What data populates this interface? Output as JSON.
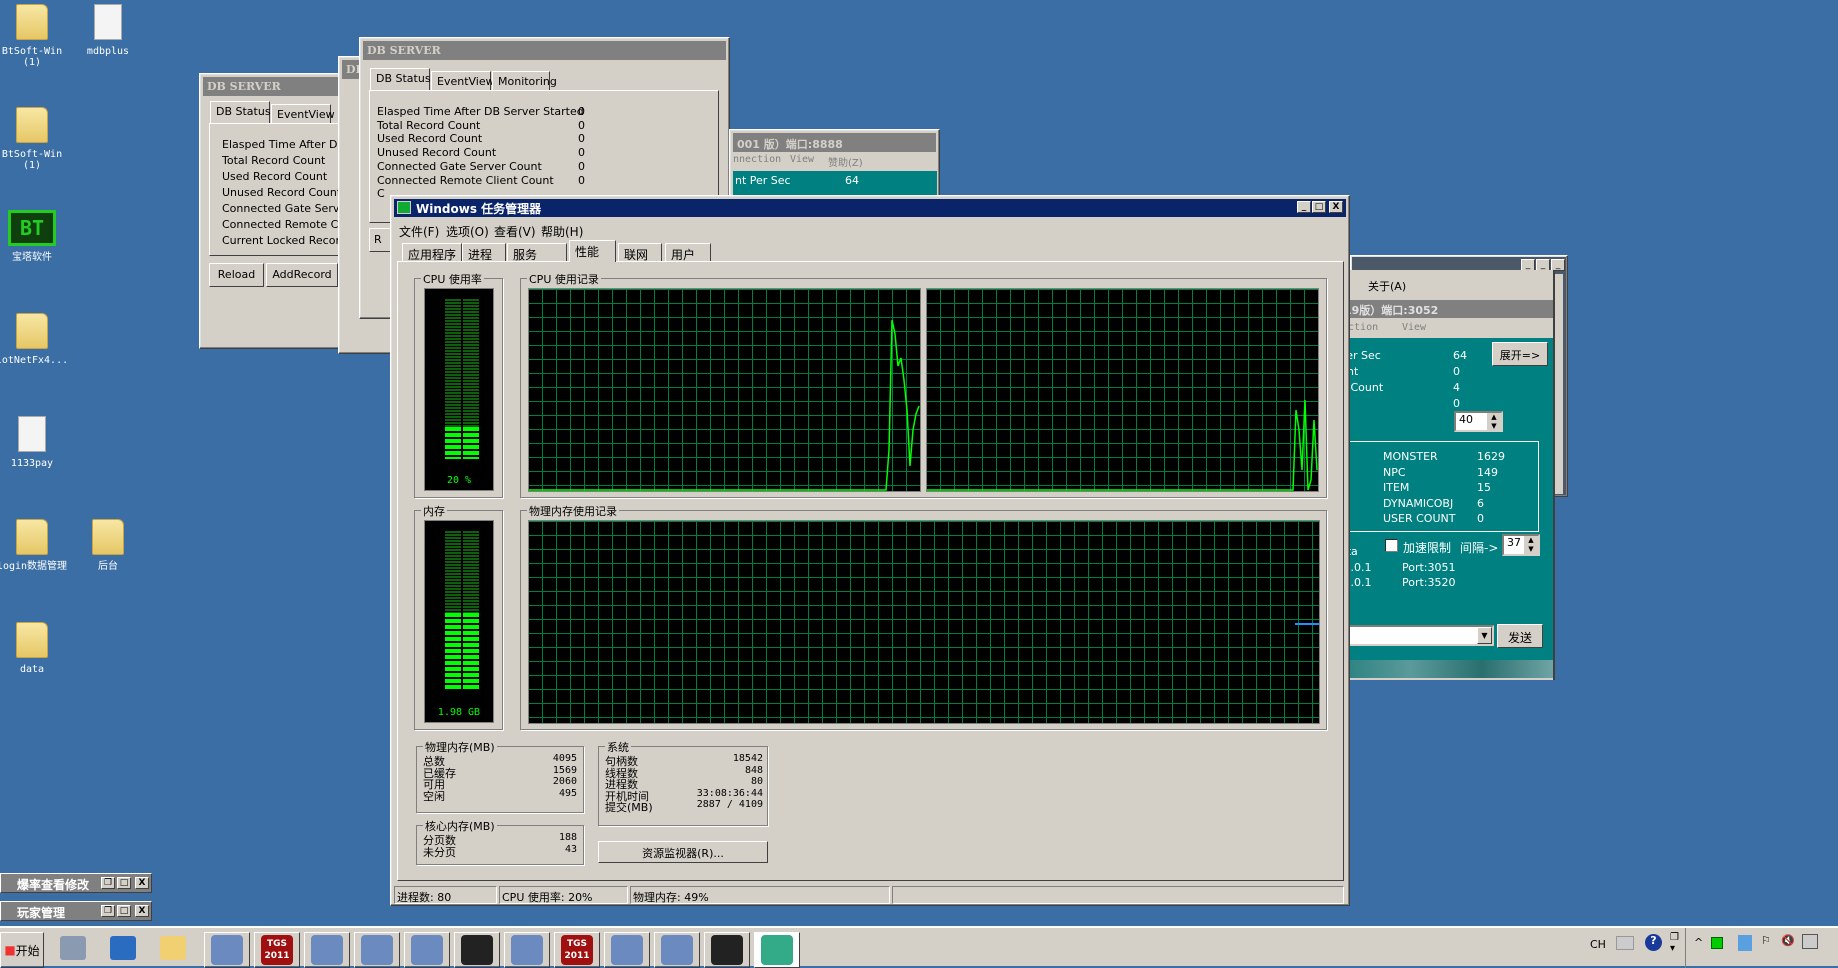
{
  "desktop": {
    "icons": [
      {
        "label": "BtSoft-Win\n(1)",
        "icon": "zip-folder-icon"
      },
      {
        "label": "mdbplus",
        "icon": "config-file-icon"
      },
      {
        "label": "BtSoft-Win\n(1)",
        "icon": "folder-icon"
      },
      {
        "label": "宝塔软件",
        "icon": "bt-panel-shortcut-icon"
      },
      {
        "label": "lotNetFx4...",
        "icon": "zip-folder-icon"
      },
      {
        "label": "1133pay",
        "icon": "notepad-file-icon"
      },
      {
        "label": "login数据管理",
        "icon": "folder-icon"
      },
      {
        "label": "后台",
        "icon": "folder-icon"
      },
      {
        "label": "data",
        "icon": "folder-icon"
      }
    ]
  },
  "db_server_back": {
    "title": "DB SERVER",
    "tabs": [
      "DB Status",
      "EventView"
    ],
    "rows": [
      "Elasped Time After DB S",
      "Total Record Count",
      "Used Record Count",
      "Unused Record Count",
      "Connected Gate Server C",
      "Connected Remote Clien",
      "Current Locked Record C"
    ],
    "buttons": [
      "Reload",
      "AddRecord"
    ]
  },
  "db_server_mid": {
    "title": "DB"
  },
  "db_server_front": {
    "title": "DB SERVER",
    "tabs": [
      "DB Status",
      "EventView",
      "Monitoring"
    ],
    "rows": [
      {
        "label": "Elasped Time After DB Server Started",
        "value": "0"
      },
      {
        "label": "Total Record Count",
        "value": "0"
      },
      {
        "label": "Used Record Count",
        "value": "0"
      },
      {
        "label": "Unused Record Count",
        "value": "0"
      },
      {
        "label": "Connected Gate Server Count",
        "value": "0"
      },
      {
        "label": "Connected Remote Client Count",
        "value": "0"
      },
      {
        "label": "C",
        "value": ""
      }
    ],
    "button_partial": "R"
  },
  "gate_window": {
    "title": "001 版）端口:8888",
    "menu": [
      "nnection",
      "View",
      "赞助(Z)"
    ],
    "row_label": "nt Per Sec",
    "row_value": "64"
  },
  "server_window": {
    "menu": "关于(A)",
    "title": "19版）端口:3052",
    "submenu": [
      "ection",
      "View"
    ],
    "rows": [
      {
        "label": "Per Sec",
        "value": "64"
      },
      {
        "label": "unt",
        "value": "0"
      },
      {
        "label": "n Count",
        "value": "4"
      },
      {
        "label": "",
        "value": "0"
      }
    ],
    "expand_button": "展开=>",
    "spin_value": "40",
    "group_label": "n",
    "stats": [
      {
        "label": "MONSTER",
        "value": "1629"
      },
      {
        "label": "NPC",
        "value": "149"
      },
      {
        "label": "ITEM",
        "value": "15"
      },
      {
        "label": "DYNAMICOBJ",
        "value": "6"
      },
      {
        "label": "USER COUNT",
        "value": "0"
      }
    ],
    "data_label": "ata",
    "speed_limit_label": "加速限制",
    "speed_limit_checked": false,
    "interval_label": "间隔->",
    "interval_value": "37",
    "addresses": [
      {
        "ip": ".0.0.1",
        "port": "Port:3051"
      },
      {
        "ip": ".0.0.1",
        "port": "Port:3520"
      }
    ],
    "command_value": "",
    "send_button": "发送"
  },
  "task_manager": {
    "title": "Windows 任务管理器",
    "menu": [
      "文件(F)",
      "选项(O)",
      "查看(V)",
      "帮助(H)"
    ],
    "tabs": [
      "应用程序",
      "进程",
      "服务",
      "性能",
      "联网",
      "用户"
    ],
    "active_tab": "性能",
    "cpu_usage": {
      "label": "CPU 使用率",
      "value_text": "20 %",
      "percent": 20
    },
    "cpu_history": {
      "label": "CPU 使用记录",
      "core1_recent": [
        0,
        0,
        0,
        20,
        85,
        78,
        62,
        66,
        55,
        40,
        12,
        30,
        38,
        42
      ],
      "core2_recent": [
        0,
        0,
        0,
        0,
        40,
        30,
        10,
        45,
        0,
        5,
        35,
        10
      ]
    },
    "memory": {
      "label": "内存",
      "value_text": "1.98 GB",
      "percent": 49
    },
    "memory_history": {
      "label": "物理内存使用记录",
      "recent_percent": [
        49,
        49,
        49,
        49
      ]
    },
    "physical_memory": {
      "label": "物理内存(MB)",
      "rows": [
        {
          "label": "总数",
          "value": "4095"
        },
        {
          "label": "已缓存",
          "value": "1569"
        },
        {
          "label": "可用",
          "value": "2060"
        },
        {
          "label": "空闲",
          "value": "495"
        }
      ]
    },
    "kernel_memory": {
      "label": "核心内存(MB)",
      "rows": [
        {
          "label": "分页数",
          "value": "188"
        },
        {
          "label": "未分页",
          "value": "43"
        }
      ]
    },
    "system": {
      "label": "系统",
      "rows": [
        {
          "label": "句柄数",
          "value": "18542"
        },
        {
          "label": "线程数",
          "value": "848"
        },
        {
          "label": "进程数",
          "value": "80"
        },
        {
          "label": "开机时间",
          "value": "33:08:36:44"
        },
        {
          "label": "提交(MB)",
          "value": "2887 / 4109"
        }
      ]
    },
    "resource_monitor_button": "资源监视器(R)...",
    "status": [
      "进程数: 80",
      "CPU 使用率: 20%",
      "物理内存: 49%"
    ]
  },
  "minimized_windows": [
    {
      "title": "爆率查看修改"
    },
    {
      "title": "玩家管理"
    }
  ],
  "taskbar": {
    "start_label": "开始",
    "quick_launch": [
      "server-manager-icon",
      "powershell-icon",
      "explorer-icon"
    ],
    "buttons": [
      {
        "icon": "app-disc-icon",
        "text": ""
      },
      {
        "icon": "tgs-2011-icon",
        "text": "TGS\n2011"
      },
      {
        "icon": "character-key-icon",
        "text": ""
      },
      {
        "icon": "torch-icon",
        "text": ""
      },
      {
        "icon": "lightning-arrow-icon",
        "text": ""
      },
      {
        "icon": "character-portrait-icon",
        "text": ""
      },
      {
        "icon": "lightning-arrow-icon",
        "text": ""
      },
      {
        "icon": "tgs-2011-icon",
        "text": "TGS\n2011"
      },
      {
        "icon": "app-disc-icon",
        "text": ""
      },
      {
        "icon": "torch-icon",
        "text": ""
      },
      {
        "icon": "character-portrait-icon",
        "text": ""
      },
      {
        "icon": "task-manager-icon",
        "text": ""
      }
    ],
    "tray": {
      "language": "CH"
    }
  },
  "colors": {
    "desktop": "#3a6ea5",
    "titlebar_active": "#0a246a",
    "graph_grid": "#008040",
    "graph_line": "#00ff00",
    "teal": "#008080"
  }
}
